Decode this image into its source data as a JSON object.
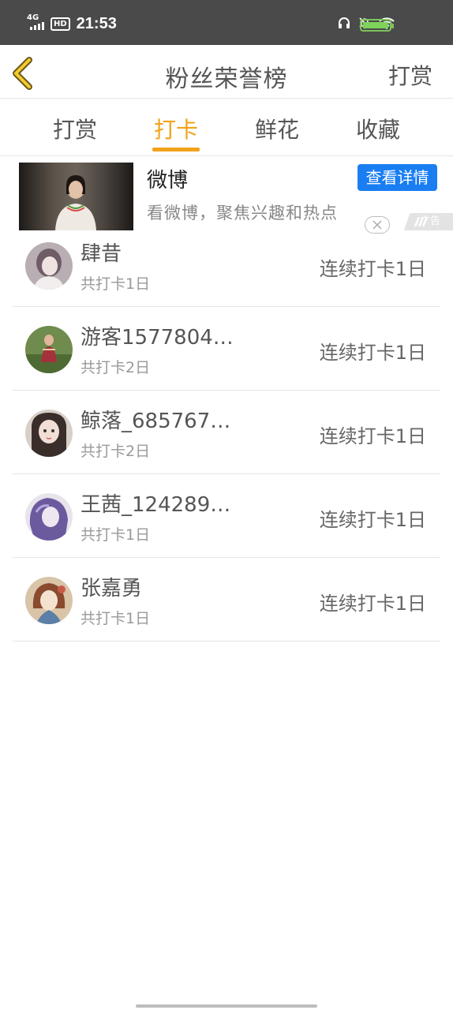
{
  "status_bar": {
    "network": "4G",
    "hd": "HD",
    "time": "21:53"
  },
  "header": {
    "title": "粉丝荣誉榜",
    "action": "打赏"
  },
  "tabs": [
    {
      "label": "打赏"
    },
    {
      "label": "打卡",
      "active": true
    },
    {
      "label": "鲜花"
    },
    {
      "label": "收藏"
    }
  ],
  "ad": {
    "title": "微博",
    "subtitle": "看微博，聚焦兴趣和热点",
    "button": "查看详情",
    "mark": "广告"
  },
  "checkin_list": [
    {
      "name": "肆昔",
      "total": "共打卡1日",
      "streak": "连续打卡1日"
    },
    {
      "name": "游客1577804…",
      "total": "共打卡2日",
      "streak": "连续打卡1日"
    },
    {
      "name": "鲸落_685767…",
      "total": "共打卡2日",
      "streak": "连续打卡1日"
    },
    {
      "name": "王茜_124289…",
      "total": "共打卡1日",
      "streak": "连续打卡1日"
    },
    {
      "name": "张嘉勇",
      "total": "共打卡1日",
      "streak": "连续打卡1日"
    }
  ],
  "colors": {
    "accent": "#f0a21a",
    "ad_button": "#1a7ef2",
    "status_bar": "#4a4a4a"
  }
}
